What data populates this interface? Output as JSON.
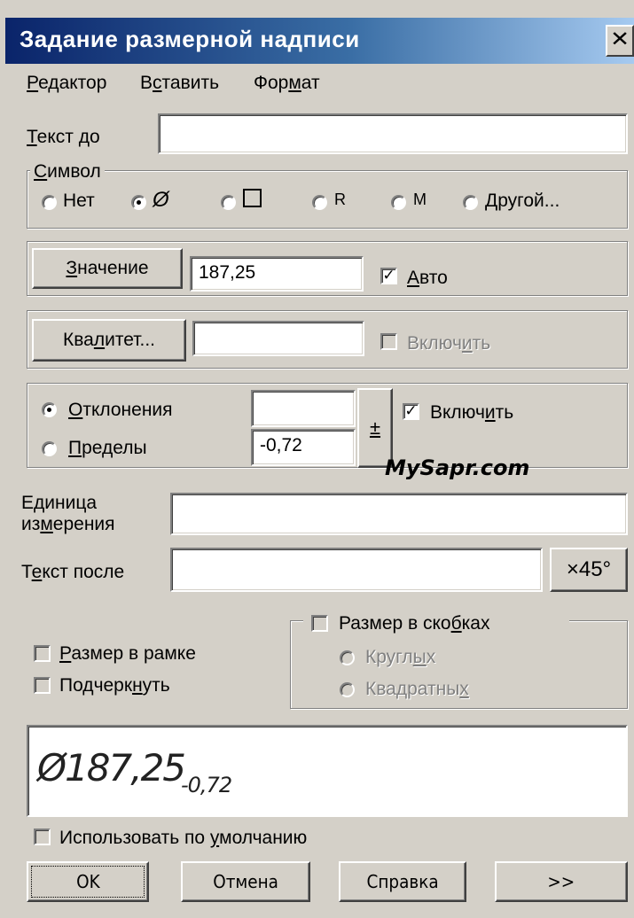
{
  "window": {
    "title": "Задание размерной надписи",
    "close_glyph": "✕"
  },
  "menu": [
    {
      "pre": "",
      "u": "Р",
      "post": "едактор"
    },
    {
      "pre": "В",
      "u": "с",
      "post": "тавить"
    },
    {
      "pre": "Фор",
      "u": "м",
      "post": "ат"
    }
  ],
  "text_before": {
    "pre": "",
    "u": "Т",
    "post": "екст до",
    "value": ""
  },
  "symbol_group": {
    "label_u": "С",
    "label_post": "имвол",
    "options": [
      {
        "label": "Нет",
        "selected": false
      },
      {
        "label": "Ø",
        "selected": true,
        "icon": "diameter-icon"
      },
      {
        "label": "□",
        "selected": false,
        "icon": "square-icon"
      },
      {
        "label": "R",
        "selected": false
      },
      {
        "label": "M",
        "selected": false
      },
      {
        "label": "Другой...",
        "selected": false
      }
    ]
  },
  "value_row": {
    "button_u": "З",
    "button_post": "начение",
    "value": "187,25",
    "auto_u": "А",
    "auto_post": "вто",
    "auto_checked": true
  },
  "qualitet_row": {
    "button_pre": "Ква",
    "button_u": "л",
    "button_post": "итет...",
    "value": "",
    "enable_pre": "Включ",
    "enable_u": "и",
    "enable_post": "ть",
    "enable_checked": false
  },
  "tolerance": {
    "deviation_u": "О",
    "deviation_post": "тклонения",
    "deviation_selected": true,
    "limits_u": "П",
    "limits_post": "ределы",
    "limits_selected": false,
    "upper_value": "",
    "lower_value": "-0,72",
    "plusminus_label": "±",
    "enable_pre": "Включ",
    "enable_u": "и",
    "enable_post": "ть",
    "enable_checked": true
  },
  "watermark": "MySapr.com",
  "units": {
    "line1": "Единица",
    "line2_pre": "из",
    "line2_u": "м",
    "line2_post": "ерения",
    "value": ""
  },
  "text_after": {
    "pre": "Т",
    "u": "е",
    "post": "кст после",
    "value": "",
    "button": "×45°"
  },
  "frame_cb": {
    "u": "Р",
    "post": "азмер в рамке",
    "checked": false
  },
  "underline_cb": {
    "pre": "Подчерк",
    "u": "н",
    "post": "уть",
    "checked": false
  },
  "brackets": {
    "pre": "Размер в ско",
    "u": "б",
    "post": "ках",
    "checked": false,
    "round_pre": "Кругл",
    "round_u": "ы",
    "round_post": "х",
    "square_pre": "Квадратны",
    "square_u": "х",
    "square_post": ""
  },
  "preview": {
    "main": "Ø187,25",
    "sub": "-0,72"
  },
  "default_cb": {
    "pre": "Использовать по ",
    "u": "у",
    "post": "молчанию",
    "checked": false
  },
  "buttons": {
    "ok": "OK",
    "cancel": "Отмена",
    "help": "Справка",
    "more": ">>"
  }
}
